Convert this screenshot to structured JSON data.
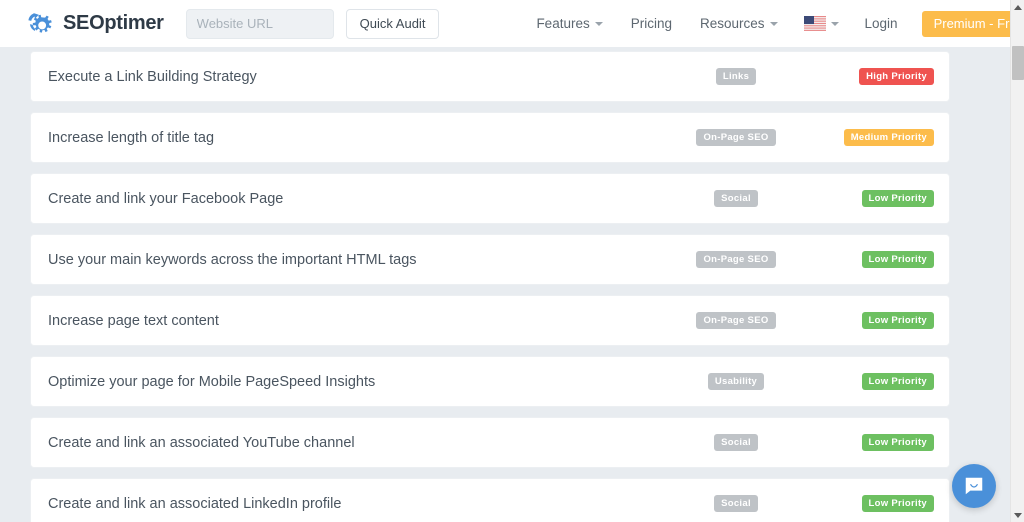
{
  "header": {
    "brand_name": "SEOptimer",
    "brand_icon": "seoptimer-gear-logo",
    "url_input": {
      "value": "",
      "placeholder": "Website URL"
    },
    "quick_audit_label": "Quick Audit",
    "nav": [
      {
        "label": "Features",
        "has_caret": true
      },
      {
        "label": "Pricing",
        "has_caret": false
      },
      {
        "label": "Resources",
        "has_caret": true
      }
    ],
    "language": {
      "flag": "us-flag-icon",
      "has_caret": true
    },
    "login_label": "Login",
    "premium_label": "Premium - Free Trial"
  },
  "recommendations": [
    {
      "title": "Execute a Link Building Strategy",
      "category": "Links",
      "priority": "High Priority",
      "priority_level": "high"
    },
    {
      "title": "Increase length of title tag",
      "category": "On-Page SEO",
      "priority": "Medium Priority",
      "priority_level": "medium"
    },
    {
      "title": "Create and link your Facebook Page",
      "category": "Social",
      "priority": "Low Priority",
      "priority_level": "low"
    },
    {
      "title": "Use your main keywords across the important HTML tags",
      "category": "On-Page SEO",
      "priority": "Low Priority",
      "priority_level": "low"
    },
    {
      "title": "Increase page text content",
      "category": "On-Page SEO",
      "priority": "Low Priority",
      "priority_level": "low"
    },
    {
      "title": "Optimize your page for Mobile PageSpeed Insights",
      "category": "Usability",
      "priority": "Low Priority",
      "priority_level": "low"
    },
    {
      "title": "Create and link an associated YouTube channel",
      "category": "Social",
      "priority": "Low Priority",
      "priority_level": "low"
    },
    {
      "title": "Create and link an associated LinkedIn profile",
      "category": "Social",
      "priority": "Low Priority",
      "priority_level": "low"
    }
  ],
  "chat": {
    "icon": "chat-message-icon"
  },
  "scrollbar": {
    "up_icon": "scroll-up-arrow-icon",
    "down_icon": "scroll-down-arrow-icon"
  },
  "colors": {
    "brand_blue": "#4a90d9",
    "premium_yellow": "#fcbc4b",
    "high_priority": "#ef5350",
    "medium_priority": "#fcbc4b",
    "low_priority": "#6dc061",
    "category_grey": "#bfc3c7",
    "page_background": "#e8ecf0"
  }
}
